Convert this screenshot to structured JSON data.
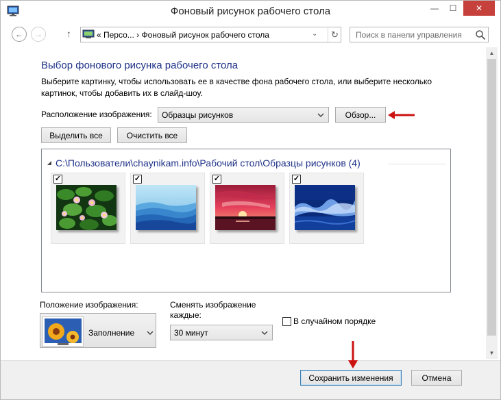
{
  "window": {
    "title": "Фоновый рисунок рабочего стола",
    "minimize": "—",
    "maximize": "☐",
    "close": "✕"
  },
  "nav": {
    "back": "←",
    "forward": "→",
    "up": "↑",
    "breadcrumb": "«  Персо...  ›  Фоновый рисунок рабочего стола",
    "dropdown": "⌄",
    "refresh": "↻",
    "search_placeholder": "Поиск в панели управления"
  },
  "main": {
    "heading": "Выбор фонового рисунка рабочего стола",
    "description": "Выберите картинку, чтобы использовать ее в качестве фона рабочего стола, или выберите несколько картинок, чтобы добавить их в слайд-шоу.",
    "location_label": "Расположение изображения:",
    "location_value": "Образцы рисунков",
    "browse_button": "Обзор...",
    "select_all_button": "Выделить все",
    "clear_all_button": "Очистить все",
    "group_title": "C:\\Пользователи\\chaynikam.info\\Рабочий стол\\Образцы рисунков (4)",
    "pictures": [
      {
        "name": "water-lilies",
        "checked": true
      },
      {
        "name": "blue-mountains",
        "checked": true
      },
      {
        "name": "red-sunset",
        "checked": true
      },
      {
        "name": "blue-waves",
        "checked": true
      }
    ],
    "check_mark": "✓",
    "position_label": "Положение изображения:",
    "position_value": "Заполнение",
    "change_label": "Сменять изображение каждые:",
    "interval_value": "30 минут",
    "shuffle_label": "В случайном порядке",
    "shuffle_checked": false
  },
  "footer": {
    "save_button": "Сохранить изменения",
    "cancel_button": "Отмена"
  },
  "colors": {
    "heading": "#1e3287",
    "close_button": "#c7413c",
    "annotation_arrow": "#cc1111"
  }
}
